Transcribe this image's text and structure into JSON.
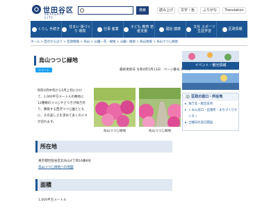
{
  "header": {
    "logo_name": "世田谷区",
    "logo_sub": "SETAGAYA CITY",
    "search_button": "検索",
    "buttons": [
      "読み上げ",
      "文字・色",
      "ふりがな",
      "Translation"
    ]
  },
  "nav": [
    "くらし 手続き",
    "住まい 街づくり 環境",
    "仕事 産業",
    "子ども 教育 若者支援",
    "福祉 健康",
    "文化 スポーツ 生涯学習",
    "区政情報"
  ],
  "breadcrumb": "ホーム > 区のからほう > 区政情報 > 烏山 > 公園・花・緑地 > 公園・緑地 > 烏山地域 > 烏山つつじ緑地",
  "page": {
    "title": "烏山つつじ緑地",
    "share": "ツイート",
    "meta": "最終更新日 令和4年5月13日　ページ番号 17552"
  },
  "intro": "例年4月中旬から5月上旬にかけて、1,000平方メートルの敷地に12種類のつつじやさつきが咲き誇り、隣接する西沢つつじ園とともに、その美しさを求めて多くの人々が訪れます。",
  "photos": [
    {
      "caption": "烏山つつじ緑地"
    },
    {
      "caption": "烏山つつじ緑地"
    }
  ],
  "sections": {
    "location": {
      "heading": "所在地",
      "address": "東京都世田谷区北烏山4丁目16番8号",
      "map_link": "烏山つつじ緑地への地図"
    },
    "area": {
      "heading": "面積",
      "value": "1,000平方メートル"
    }
  },
  "sidebar": {
    "event_label": "イベント・観光情報",
    "box_title": "区政の窓口・所在地",
    "links": [
      "本庁舎・総合支所",
      "くみん窓口・出張所・まちづくりセンター",
      "土曜日の窓口開設"
    ]
  },
  "colors": {
    "brand": "#1b5593",
    "dark": "#1b3f7a"
  }
}
